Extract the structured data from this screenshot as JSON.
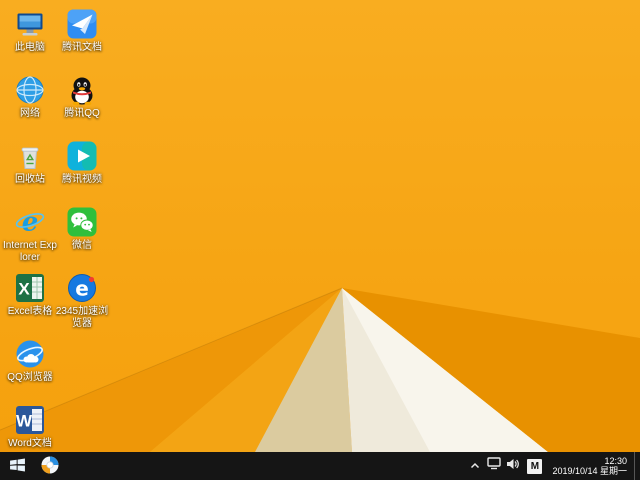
{
  "desktop": {
    "columns": [
      {
        "x": 2,
        "icons": [
          {
            "id": "this-pc",
            "label": "此电脑"
          },
          {
            "id": "network",
            "label": "网络"
          },
          {
            "id": "recycle-bin",
            "label": "回收站"
          },
          {
            "id": "internet-explorer",
            "label": "Internet Explorer"
          },
          {
            "id": "excel",
            "label": "Excel表格"
          },
          {
            "id": "qq-browser",
            "label": "QQ浏览器"
          },
          {
            "id": "word",
            "label": "Word文档"
          }
        ]
      },
      {
        "x": 54,
        "icons": [
          {
            "id": "tencent-docs",
            "label": "腾讯文档"
          },
          {
            "id": "qq",
            "label": "腾讯QQ"
          },
          {
            "id": "tencent-video",
            "label": "腾讯视频"
          },
          {
            "id": "wechat",
            "label": "微信"
          },
          {
            "id": "browser-2345",
            "label": "2345加速浏览器"
          }
        ]
      }
    ]
  },
  "taskbar": {
    "input_indicator": "M",
    "clock": {
      "time": "12:30",
      "date": "2019/10/14 星期一"
    }
  },
  "colors": {
    "wallpaper_base_top": "#F9AD20",
    "wallpaper_base_bottom": "#F5A00C",
    "shade_left_a": "#EE9708",
    "shade_left_b": "#F3A414",
    "tan_tri": "#DBCB9F",
    "white_tri": "#EFEADB",
    "white_tri_bright": "#F8F5EC",
    "deep_right": "#E89100",
    "taskbar_bg": "#151515",
    "label_text": "#FFFFFF"
  }
}
